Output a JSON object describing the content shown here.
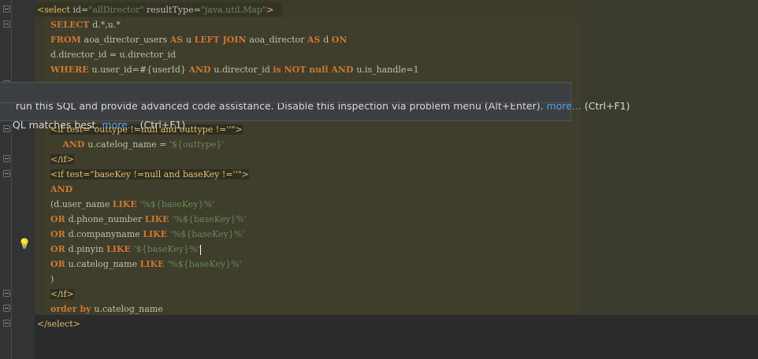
{
  "editor": {
    "lines": [
      {
        "segs": [
          {
            "t": "<select ",
            "c": "tag"
          },
          {
            "t": "id=",
            "c": "attr"
          },
          {
            "t": "\"allDirector\"",
            "c": "str"
          },
          {
            "t": " resultType=",
            "c": "attr"
          },
          {
            "t": "\"java.util.Map\"",
            "c": "str"
          },
          {
            "t": ">",
            "c": "tag"
          }
        ]
      },
      {
        "segs": [
          {
            "t": "SELECT ",
            "c": "kw"
          },
          {
            "t": "d.*,u.*",
            "c": "plain"
          }
        ]
      },
      {
        "segs": [
          {
            "t": "FROM ",
            "c": "kw"
          },
          {
            "t": "aoa_director_users ",
            "c": "plain"
          },
          {
            "t": "AS ",
            "c": "kw"
          },
          {
            "t": "u ",
            "c": "plain"
          },
          {
            "t": "LEFT JOIN ",
            "c": "kw"
          },
          {
            "t": "aoa_director ",
            "c": "plain"
          },
          {
            "t": "AS ",
            "c": "kw"
          },
          {
            "t": "d ",
            "c": "plain"
          },
          {
            "t": "ON",
            "c": "kw"
          }
        ]
      },
      {
        "segs": [
          {
            "t": "d.director_id = u.director_id",
            "c": "plain"
          }
        ]
      },
      {
        "segs": [
          {
            "t": "WHERE ",
            "c": "kw"
          },
          {
            "t": "u.user_id=#{userId} ",
            "c": "plain"
          },
          {
            "t": "AND ",
            "c": "kw"
          },
          {
            "t": "u.director_id ",
            "c": "plain"
          },
          {
            "t": "is NOT null AND ",
            "c": "kw"
          },
          {
            "t": "u.is_handle=1",
            "c": "plain"
          }
        ]
      },
      {
        "segs": [
          {
            "t": "<if test=\"outtype !=null and outtype !=''\">",
            "c": "tag"
          }
        ]
      },
      {
        "segs": [
          {
            "t": "    AND ",
            "c": "kw"
          },
          {
            "t": "u.catelog_name = ",
            "c": "plain"
          },
          {
            "t": "'${outtype}'",
            "c": "str"
          }
        ]
      },
      {
        "segs": [
          {
            "t": "</if>",
            "c": "tag"
          }
        ]
      },
      {
        "segs": [
          {
            "t": "<if test=\"baseKey !=null and baseKey !=''\">",
            "c": "tag"
          }
        ]
      },
      {
        "segs": [
          {
            "t": "AND",
            "c": "kw"
          }
        ]
      },
      {
        "segs": [
          {
            "t": "(d.user_name ",
            "c": "plain"
          },
          {
            "t": "LIKE ",
            "c": "kw"
          },
          {
            "t": "'%${baseKey}%'",
            "c": "str"
          }
        ]
      },
      {
        "segs": [
          {
            "t": "OR ",
            "c": "kw"
          },
          {
            "t": "d.phone_number ",
            "c": "plain"
          },
          {
            "t": "LIKE ",
            "c": "kw"
          },
          {
            "t": "'%${baseKey}%'",
            "c": "str"
          }
        ]
      },
      {
        "segs": [
          {
            "t": "OR ",
            "c": "kw"
          },
          {
            "t": "d.companyname ",
            "c": "plain"
          },
          {
            "t": "LIKE ",
            "c": "kw"
          },
          {
            "t": "'%${baseKey}%'",
            "c": "str"
          }
        ]
      },
      {
        "segs": [
          {
            "t": "OR ",
            "c": "kw"
          },
          {
            "t": "d.pinyin ",
            "c": "plain"
          },
          {
            "t": "LIKE ",
            "c": "kw"
          },
          {
            "t": "'${baseKey}%'",
            "c": "str"
          }
        ]
      },
      {
        "segs": [
          {
            "t": "OR ",
            "c": "kw"
          },
          {
            "t": "u.catelog_name ",
            "c": "plain"
          },
          {
            "t": "LIKE ",
            "c": "kw"
          },
          {
            "t": "'%${baseKey}%'",
            "c": "str"
          }
        ]
      },
      {
        "segs": [
          {
            "t": ")",
            "c": "plain"
          }
        ]
      },
      {
        "segs": [
          {
            "t": "</if>",
            "c": "tag"
          }
        ]
      },
      {
        "segs": [
          {
            "t": "order by ",
            "c": "kw"
          },
          {
            "t": "u.catelog_name",
            "c": "plain"
          }
        ]
      },
      {
        "segs": [
          {
            "t": "</select>",
            "c": "tag"
          }
        ]
      }
    ]
  },
  "tooltip": {
    "line1_text": "run this SQL and provide advanced code assistance. Disable this inspection via problem menu (Alt+Enter). ",
    "line1_link": "more...",
    "line1_shortcut": " (Ctrl+F1)",
    "line2_text": "QL matches best. ",
    "line2_link": "more...",
    "line2_shortcut": " (Ctrl+F1)"
  },
  "icons": {
    "intention": "lightbulb-icon",
    "fold": "fold-marker-icon"
  }
}
